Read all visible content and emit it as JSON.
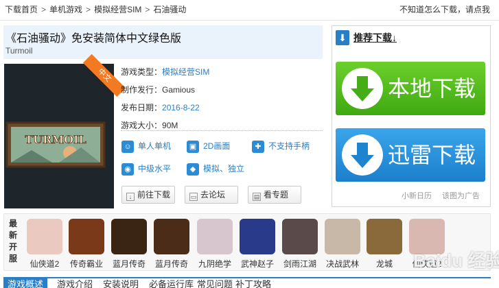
{
  "breadcrumb": [
    "下载首页",
    "单机游戏",
    "模拟经营SIM",
    "石油骚动"
  ],
  "breadcrumb_sep": ">",
  "help_text": "不知道怎么下载，请点我",
  "title": "《石油骚动》免安装简体中文绿色版",
  "subtitle": "Turmoil",
  "cover": {
    "ribbon": "中文",
    "logo": "TURMOIL"
  },
  "info": [
    {
      "label": "游戏类型：",
      "value": "模拟经营SIM",
      "link": true
    },
    {
      "label": "制作发行：",
      "value": "Gamious",
      "link": false
    },
    {
      "label": "发布日期：",
      "value": "2016-8-22",
      "link": true
    },
    {
      "label": "游戏大小：",
      "value": "90M",
      "link": false
    }
  ],
  "features": [
    "单人单机",
    "2D画面",
    "不支持手柄",
    "中级水平",
    "模拟、独立"
  ],
  "buttons": {
    "goto_download": "前往下载",
    "forum": "去论坛",
    "topic": "看专题"
  },
  "right": {
    "recommend": "推荐下载↓",
    "local_download": "本地下载",
    "thunder_download": "迅雷下载",
    "ad_left": "小新日历",
    "ad_right": "该图为广告"
  },
  "new_label": "最新开服",
  "games": [
    {
      "name": "仙侠道2",
      "color": "#e9c9c0"
    },
    {
      "name": "传奇霸业",
      "color": "#7a3a1a"
    },
    {
      "name": "蓝月传奇",
      "color": "#3a2414"
    },
    {
      "name": "蓝月传奇",
      "color": "#4a2c18"
    },
    {
      "name": "九阴绝学",
      "color": "#d8c6cf"
    },
    {
      "name": "武神赵子",
      "color": "#2a3a8a"
    },
    {
      "name": "剑雨江湖",
      "color": "#5a4a4a"
    },
    {
      "name": "决战武林",
      "color": "#c8b8a8"
    },
    {
      "name": "龙城",
      "color": "#8a6a3a"
    },
    {
      "name": "仙侠道2",
      "color": "#d8b8b0"
    }
  ],
  "tabs": [
    "游戏概述",
    "游戏介绍",
    "安装说明",
    "必备运行库",
    "常见问题",
    "补丁攻略"
  ],
  "watermark": "Baidu 经验"
}
